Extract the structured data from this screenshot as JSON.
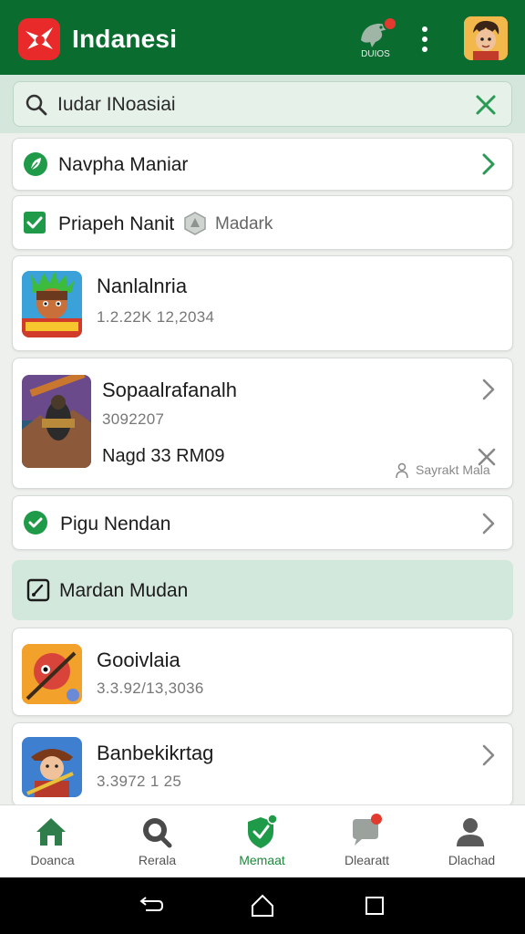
{
  "app_bar": {
    "title": "Indanesi",
    "notification_label": "DUIOS",
    "logo_icon": "app-logo-icon",
    "avatar_icon": "user-avatar"
  },
  "search": {
    "value": "Iudar INoasiai",
    "clear_icon": "close-icon"
  },
  "rows": {
    "row1": {
      "title": "Navpha Maniar"
    },
    "row2": {
      "title": "Priapeh Nanit",
      "tag": "Madark"
    },
    "game1": {
      "title": "Nanlalnria",
      "subtitle": "1.2.22K 12,2034"
    },
    "game2": {
      "title": "Sopaalrafanalh",
      "subtitle": "3092207",
      "detail": "Nagd 33 RM09",
      "action": "Sayrakt Mala"
    },
    "row3": {
      "title": "Pigu Nendan"
    },
    "section": {
      "title": "Mardan Mudan"
    },
    "game3": {
      "title": "Gooivlaia",
      "subtitle": "3.3.92/13,3036"
    },
    "game4": {
      "title": "Banbekikrtag",
      "subtitle": "3.3972 1 25"
    }
  },
  "bottom_nav": [
    {
      "label": "Doanca",
      "icon": "home-icon"
    },
    {
      "label": "Rerala",
      "icon": "search-icon"
    },
    {
      "label": "Memaat",
      "icon": "shield-icon",
      "active": true
    },
    {
      "label": "Dlearatt",
      "icon": "chat-icon"
    },
    {
      "label": "Dlachad",
      "icon": "profile-icon"
    }
  ],
  "colors": {
    "app_bar": "#0a6d2f",
    "accent": "#1a8a3a",
    "badge": "#e23a2e",
    "section_bg": "#d3e8dc"
  }
}
